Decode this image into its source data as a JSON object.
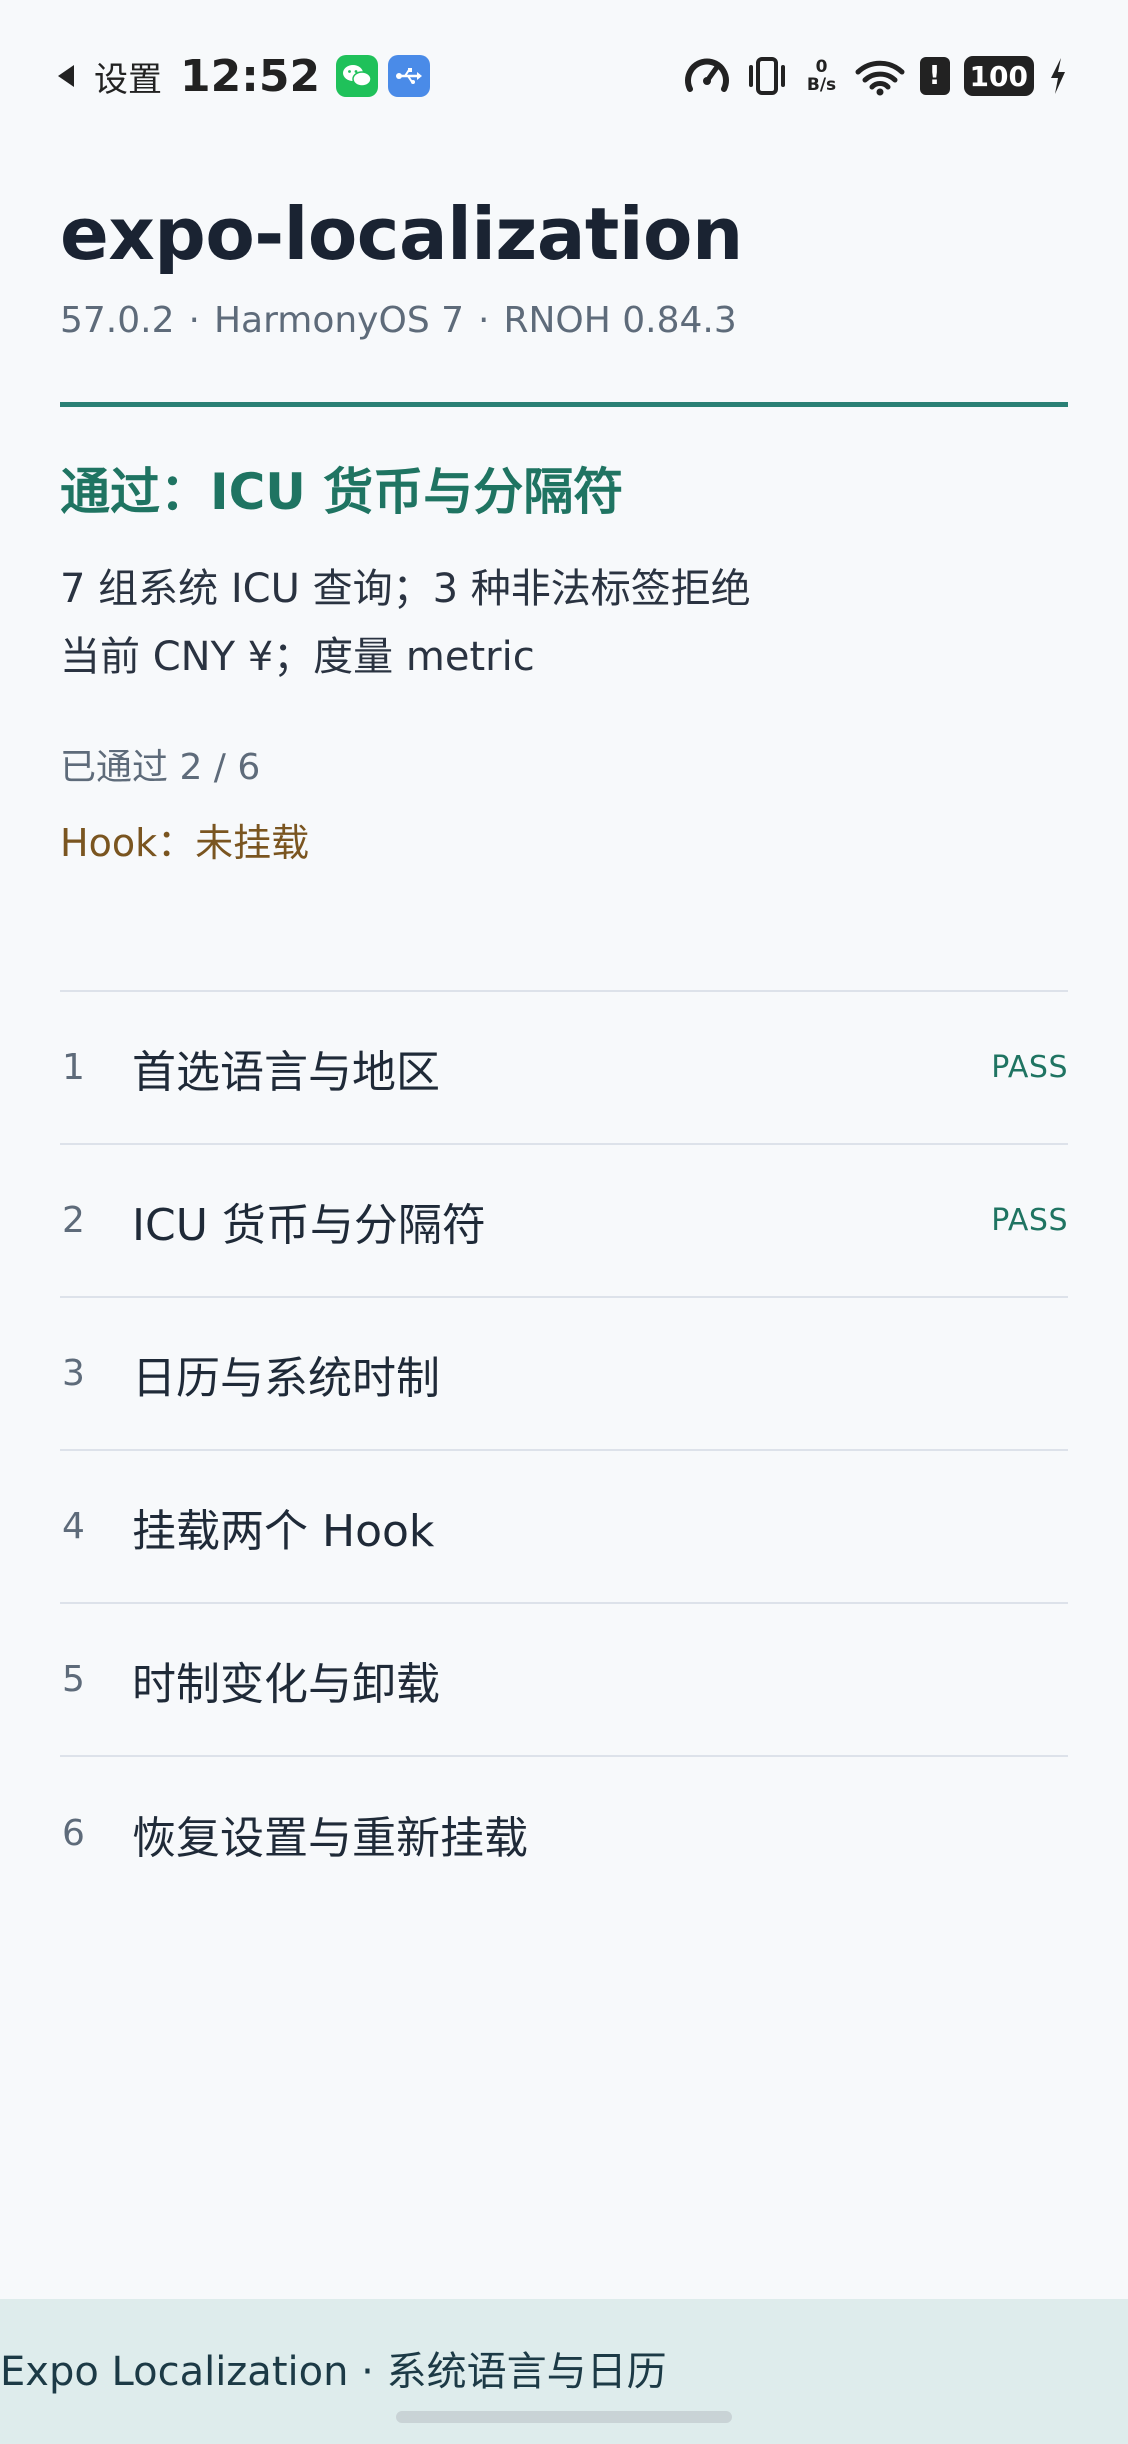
{
  "status_bar": {
    "back_label": "设置",
    "time": "12:52",
    "net_speed_value": "0",
    "net_speed_unit": "B/s",
    "alert": "!",
    "battery": "100"
  },
  "header": {
    "title": "expo-localization",
    "meta": [
      "57.0.2",
      "HarmonyOS 7",
      "RNOH 0.84.3"
    ],
    "meta_separator": "·"
  },
  "current": {
    "title": "通过：ICU 货币与分隔符",
    "detail_line1": "7 组系统 ICU 查询；3 种非法标签拒绝",
    "detail_line2": "当前 CNY ¥；度量 metric",
    "progress": "已通过 2 / 6",
    "hook": "Hook：未挂载"
  },
  "steps": [
    {
      "num": "1",
      "label": "首选语言与地区",
      "status": "PASS"
    },
    {
      "num": "2",
      "label": "ICU 货币与分隔符",
      "status": "PASS"
    },
    {
      "num": "3",
      "label": "日历与系统时制",
      "status": ""
    },
    {
      "num": "4",
      "label": "挂载两个 Hook",
      "status": ""
    },
    {
      "num": "5",
      "label": "时制变化与卸载",
      "status": ""
    },
    {
      "num": "6",
      "label": "恢复设置与重新挂载",
      "status": ""
    }
  ],
  "footer": {
    "text": "Expo Localization · 系统语言与日历"
  },
  "colors": {
    "accent": "#2a8075",
    "pass": "#1f7462",
    "hook": "#7a5520",
    "footer_bg": "#deecec"
  }
}
